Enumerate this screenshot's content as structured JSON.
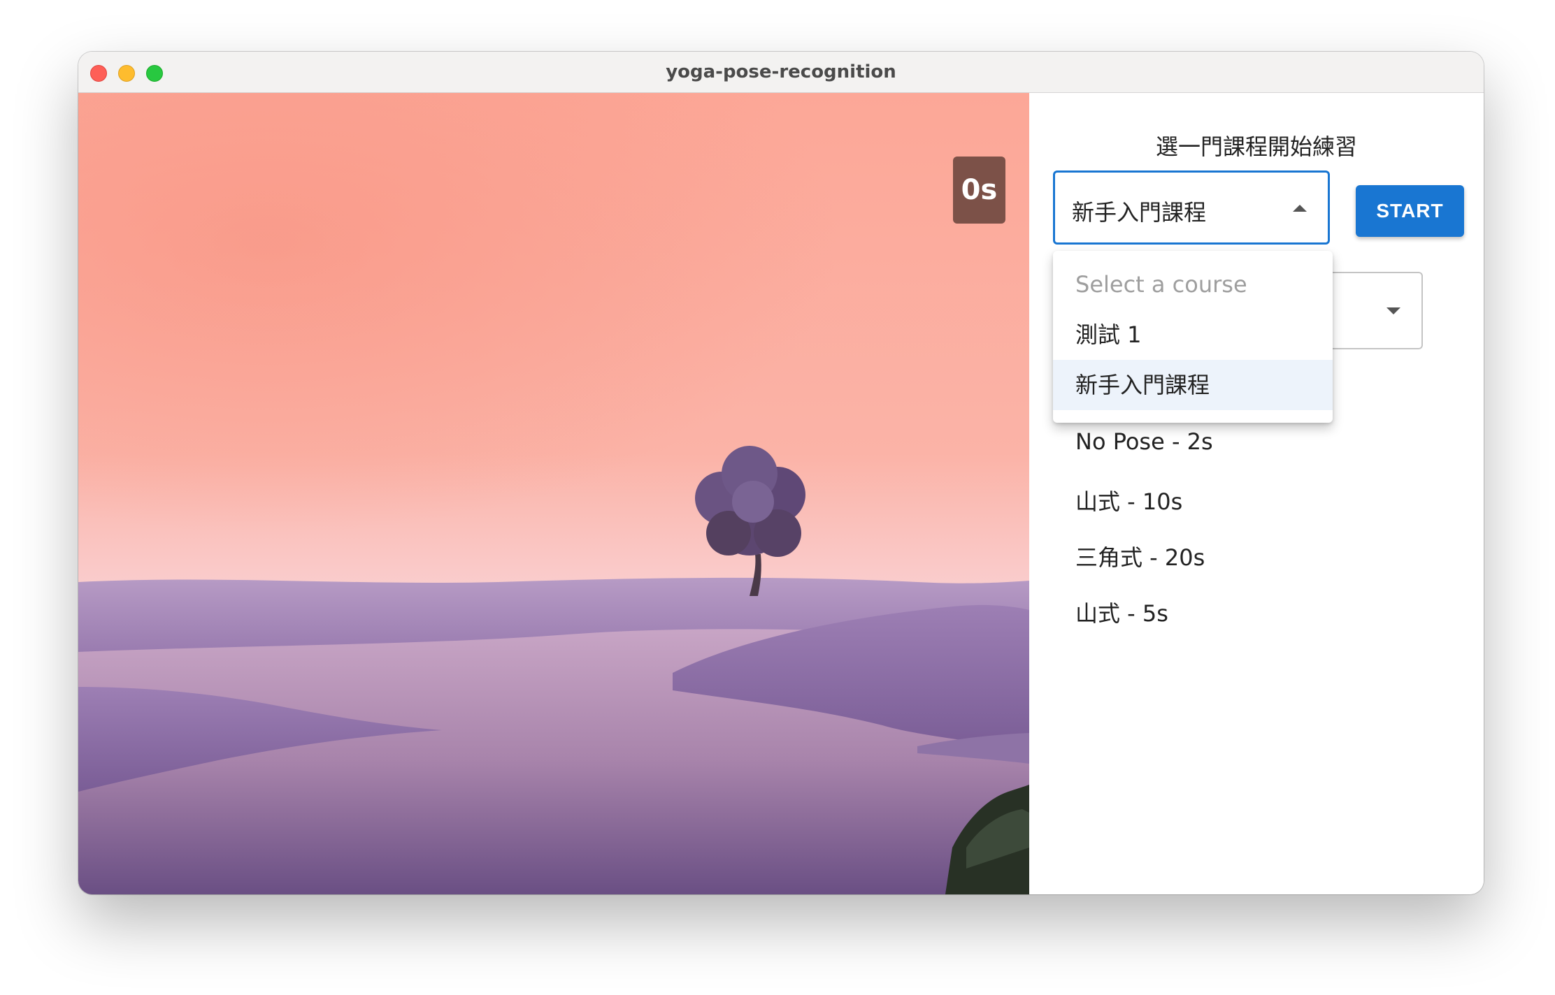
{
  "window": {
    "title": "yoga-pose-recognition"
  },
  "video": {
    "timer": "0s"
  },
  "panel": {
    "heading": "選一門課程開始練習",
    "course_select": {
      "value": "新手入門課程",
      "open": true,
      "options": [
        {
          "label": "Select a course",
          "placeholder": true
        },
        {
          "label": "測試 1"
        },
        {
          "label": "新手入門課程",
          "selected": true
        }
      ]
    },
    "start_label": "START",
    "poses": [
      "No Pose - 2s",
      "山式 - 10s",
      "三角式 - 20s",
      "山式 - 5s"
    ]
  },
  "colors": {
    "accent": "#1976d2",
    "timer_bg": "#7c5148",
    "menu_selected_bg": "#edf3fb",
    "placeholder_text": "#9e9e9e"
  }
}
